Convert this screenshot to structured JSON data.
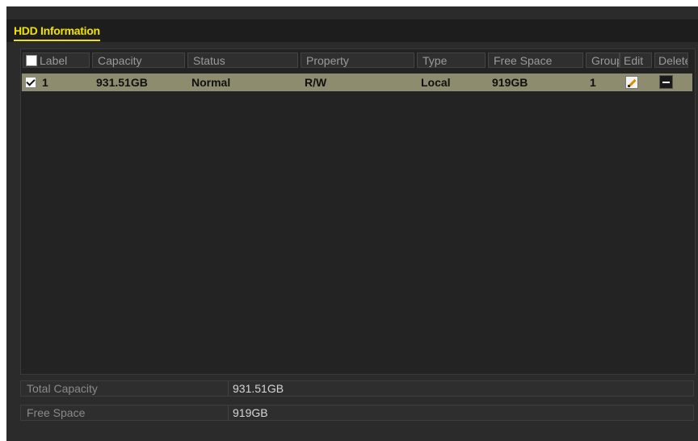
{
  "tab": {
    "label": "HDD Information"
  },
  "table": {
    "columns": [
      "Label",
      "Capacity",
      "Status",
      "Property",
      "Type",
      "Free Space",
      "Group",
      "Edit",
      "Delete"
    ],
    "rows": [
      {
        "checked": true,
        "label": "1",
        "capacity": "931.51GB",
        "status": "Normal",
        "property": "R/W",
        "type": "Local",
        "free_space": "919GB",
        "group": "1",
        "edit_icon": "edit-pencil-icon",
        "delete_icon": "minus-delete-icon"
      }
    ]
  },
  "summary": {
    "total_capacity_label": "Total Capacity",
    "total_capacity_value": "931.51GB",
    "free_space_label": "Free Space",
    "free_space_value": "919GB"
  },
  "colors": {
    "tab_accent": "#f2e200",
    "selected_row": "#8e8c6e",
    "panel_bg": "#2b2b2b"
  }
}
